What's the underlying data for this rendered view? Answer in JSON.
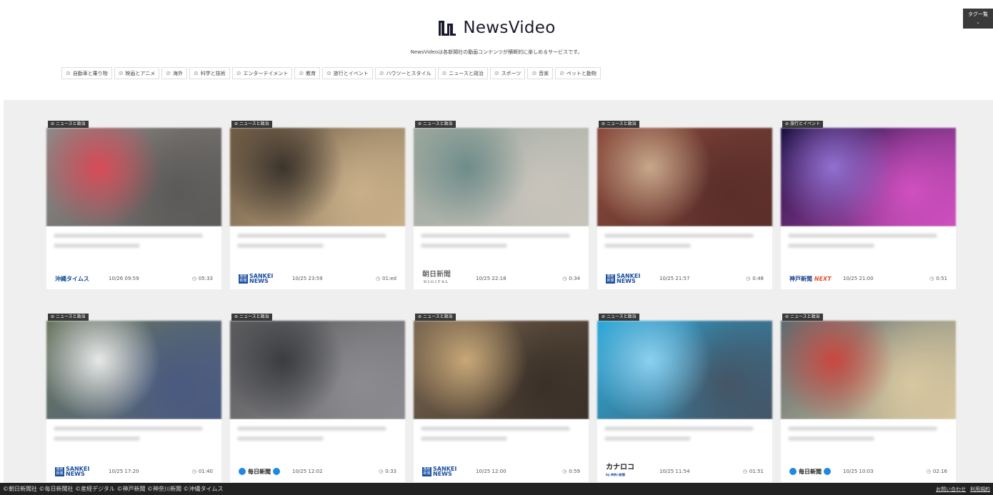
{
  "header": {
    "logo_text": "NewsVideo",
    "tagline": "NewsVideoは各新聞社の動画コンテンツが横断的に楽しめるサービスです。",
    "tag_list_button": "タグ一覧",
    "tags": [
      "自動車と乗り物",
      "映画とアニメ",
      "海外",
      "科学と技術",
      "エンターテイメント",
      "教育",
      "旅行とイベント",
      "ハウツーとスタイル",
      "ニュースと政治",
      "スポーツ",
      "音楽",
      "ペットと動物"
    ]
  },
  "cards": [
    {
      "badge": "ニュースと政治",
      "publisher": "沖縄タイムス",
      "date": "10/26 09:59",
      "duration": "05:33",
      "theme": [
        "#8e8a88",
        "#d84b58",
        "#5c5a58"
      ]
    },
    {
      "badge": "ニュースと政治",
      "publisher": "SANKEI NEWS",
      "date": "10/25 23:59",
      "duration": "01:ed",
      "theme": [
        "#6e5a44",
        "#3c342c",
        "#c9b08a"
      ]
    },
    {
      "badge": "ニュースと政治",
      "publisher": "朝日新聞 DIGITAL",
      "date": "10/25 22:18",
      "duration": "0:34",
      "theme": [
        "#9aa69c",
        "#6f8c8a",
        "#c8c4bc"
      ]
    },
    {
      "badge": "ニュースと政治",
      "publisher": "SANKEI NEWS",
      "date": "10/25 21:57",
      "duration": "0:48",
      "theme": [
        "#8a4a3c",
        "#c7a88a",
        "#5a2e2a"
      ]
    },
    {
      "badge": "旅行とイベント",
      "publisher": "神戸新聞 NEXT",
      "date": "10/25 21:00",
      "duration": "0:51",
      "theme": [
        "#1a1040",
        "#9070d0",
        "#d050c0"
      ]
    },
    {
      "badge": "ニュースと政治",
      "publisher": "SANKEI NEWS",
      "date": "10/25 17:20",
      "duration": "01:40",
      "theme": [
        "#6a7860",
        "#e8e8e8",
        "#4a5a80"
      ]
    },
    {
      "badge": "ニュースと政治",
      "publisher": "毎日新聞",
      "date": "10/25 12:02",
      "duration": "0:33",
      "theme": [
        "#5a5a5c",
        "#3a3c40",
        "#8c8c90"
      ]
    },
    {
      "badge": "ニュースと政治",
      "publisher": "SANKEI NEWS",
      "date": "10/25 12:00",
      "duration": "0:59",
      "theme": [
        "#7a6650",
        "#c8a878",
        "#3a3028"
      ]
    },
    {
      "badge": "ニュースと政治",
      "publisher": "カナロコ",
      "date": "10/25 11:54",
      "duration": "01:51",
      "theme": [
        "#2aa8d8",
        "#8cd0f0",
        "#445566"
      ]
    },
    {
      "badge": "ニュースと政治",
      "publisher": "毎日新聞",
      "date": "10/25 10:03",
      "duration": "02:16",
      "theme": [
        "#5a6a70",
        "#c84840",
        "#d8c8a0"
      ]
    }
  ],
  "footer": {
    "copyright": "©朝日新聞社 ©毎日新聞社 ©産経デジタル ©神戸新聞 ©神奈川新聞 ©沖縄タイムス",
    "contact": "お問い合わせ",
    "terms": "利用規約"
  }
}
